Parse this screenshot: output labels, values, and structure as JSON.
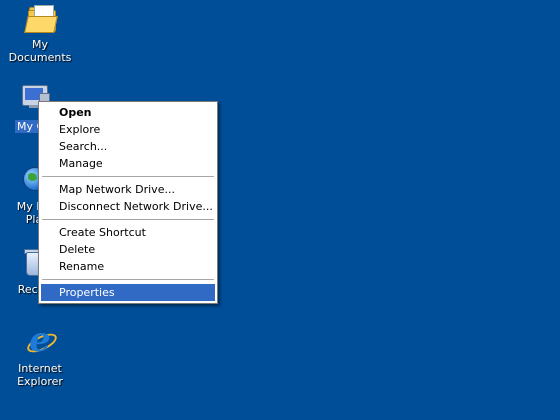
{
  "desktop": {
    "background_color": "#004e98",
    "icons": [
      {
        "label": "My Documents",
        "icon": "folder-icon"
      },
      {
        "label": "My Co",
        "icon": "computer-icon"
      },
      {
        "label_line1": "My Ne",
        "label_line2": "Pla",
        "icon": "network-globe-icon"
      },
      {
        "label": "Recyc",
        "icon": "recycle-bin-icon"
      },
      {
        "label_line1": "Internet",
        "label_line2": "Explorer",
        "icon": "ie-icon"
      }
    ]
  },
  "context_menu": {
    "items": [
      {
        "label": "Open",
        "bold": true
      },
      {
        "label": "Explore"
      },
      {
        "label": "Search..."
      },
      {
        "label": "Manage"
      },
      {
        "label": "Map Network Drive..."
      },
      {
        "label": "Disconnect Network Drive..."
      },
      {
        "label": "Create Shortcut"
      },
      {
        "label": "Delete"
      },
      {
        "label": "Rename"
      },
      {
        "label": "Properties",
        "highlighted": true
      }
    ],
    "highlight_color": "#316ac5"
  }
}
